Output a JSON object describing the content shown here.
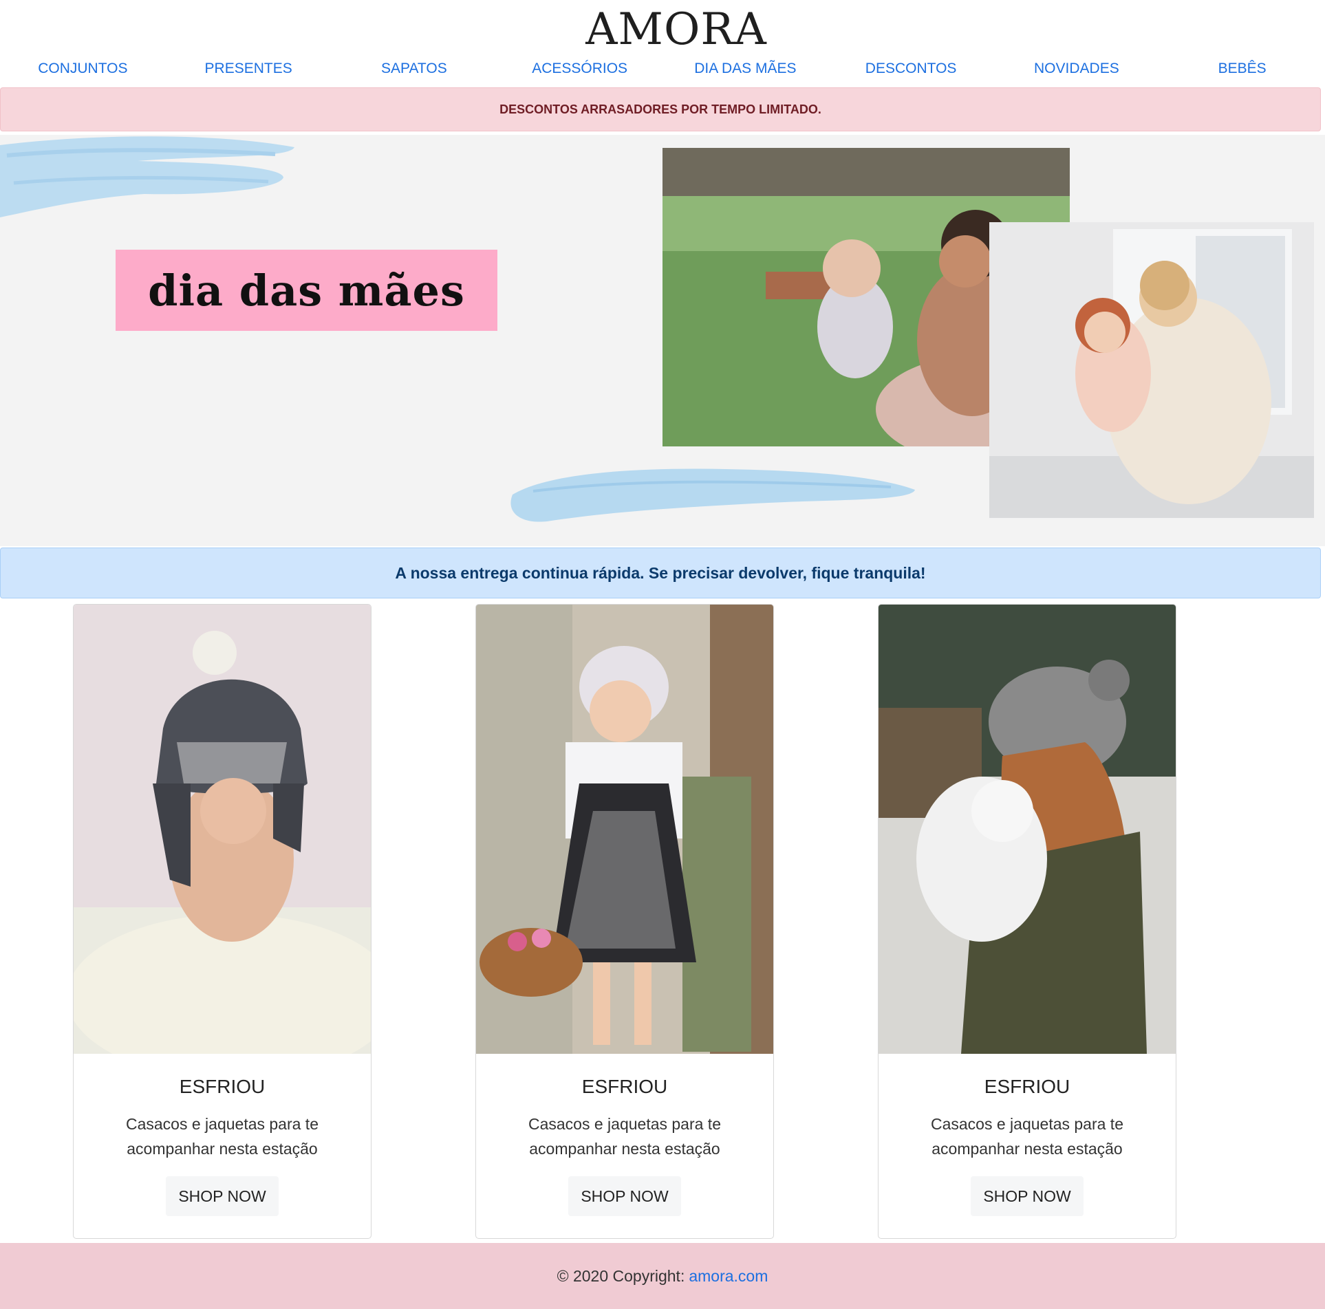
{
  "header": {
    "brand": "AMORA",
    "nav": [
      {
        "label": "CONJUNTOS"
      },
      {
        "label": "PRESENTES"
      },
      {
        "label": "SAPATOS"
      },
      {
        "label": "ACESSÓRIOS"
      },
      {
        "label": "DIA DAS MÃES"
      },
      {
        "label": "DESCONTOS"
      },
      {
        "label": "NOVIDADES"
      },
      {
        "label": "BEBÊS"
      }
    ]
  },
  "promo": {
    "text": "DESCONTOS ARRASADORES POR TEMPO LIMITADO."
  },
  "hero": {
    "label": "dia das mães"
  },
  "info": {
    "text": "A nossa entrega continua rápida. Se precisar devolver, fique tranquila!"
  },
  "cards": [
    {
      "title": "ESFRIOU",
      "text": "Casacos e jaquetas para te acompanhar nesta estação",
      "button": "SHOP NOW"
    },
    {
      "title": "ESFRIOU",
      "text": "Casacos e jaquetas para te acompanhar nesta estação",
      "button": "SHOP NOW"
    },
    {
      "title": "ESFRIOU",
      "text": "Casacos e jaquetas para te acompanhar nesta estação",
      "button": "SHOP NOW"
    }
  ],
  "footer": {
    "copyright": "© 2020 Copyright:",
    "link": "amora.com"
  },
  "colors": {
    "nav_link": "#1c6fe0",
    "promo_bg": "#f7d6db",
    "promo_text": "#6f1d25",
    "hero_bg": "#f3f3f3",
    "hero_label_bg": "#fdabc9",
    "info_bg": "#cfe5fd",
    "info_text": "#0b3a6b",
    "footer_bg": "#f0cbd3"
  }
}
